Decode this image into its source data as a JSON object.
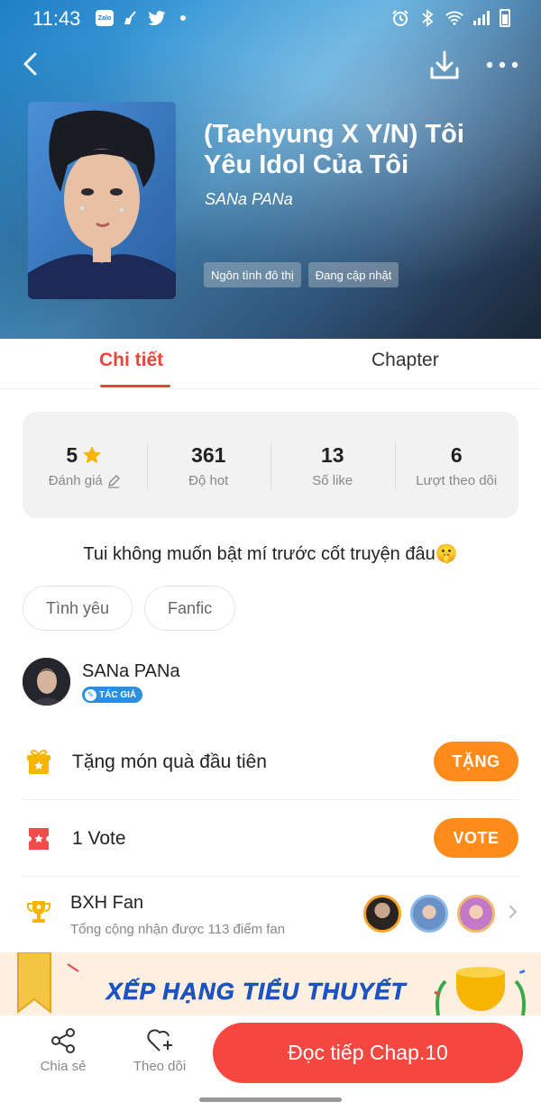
{
  "status_bar": {
    "time": "11:43",
    "left_icons": [
      "zalo-icon",
      "broom-icon",
      "twitter-icon",
      "dot-icon"
    ],
    "right_icons": [
      "alarm-icon",
      "bluetooth-icon",
      "wifi-icon",
      "signal-icon",
      "battery-icon"
    ],
    "zalo_text": "Zalo"
  },
  "header": {
    "back_icon": "back-arrow-icon",
    "download_icon": "download-icon",
    "more_icon": "more-dots-icon"
  },
  "story": {
    "title": "(Taehyung X Y/N) Tôi Yêu Idol Của Tôi",
    "author": "SANa PANa",
    "tags": [
      "Ngôn tình đô thị",
      "Đang cập nhật"
    ]
  },
  "tabs": [
    {
      "label": "Chi tiết",
      "active": true
    },
    {
      "label": "Chapter",
      "active": false
    }
  ],
  "stats": [
    {
      "value": "5",
      "label": "Đánh giá",
      "icon": "star-icon",
      "label_icon": "pencil-icon"
    },
    {
      "value": "361",
      "label": "Độ hot"
    },
    {
      "value": "13",
      "label": "Số like"
    },
    {
      "value": "6",
      "label": "Lượt theo dõi"
    }
  ],
  "summary": "Tui không muốn bật mí trước cốt truyện đâu🤫",
  "genres": [
    "Tình yêu",
    "Fanfic"
  ],
  "author": {
    "name": "SANa PANa",
    "badge": "TÁC GIẢ"
  },
  "gift": {
    "text": "Tặng món quà đầu tiên",
    "button": "TẶNG"
  },
  "vote": {
    "text": "1 Vote",
    "button": "VOTE"
  },
  "fan_rank": {
    "title": "BXH Fan",
    "subtitle": "Tổng cộng nhận được 113 điểm fan"
  },
  "banner": {
    "text": "XẾP HẠNG TIỂU THUYẾT"
  },
  "bottom_bar": {
    "share_label": "Chia sẻ",
    "follow_label": "Theo dõi",
    "read_button": "Đọc tiếp Chap.10"
  },
  "colors": {
    "accent_red": "#e8453a",
    "button_orange": "#ff8c1a",
    "read_button": "#f5473f",
    "badge_blue": "#2a8fe0"
  }
}
